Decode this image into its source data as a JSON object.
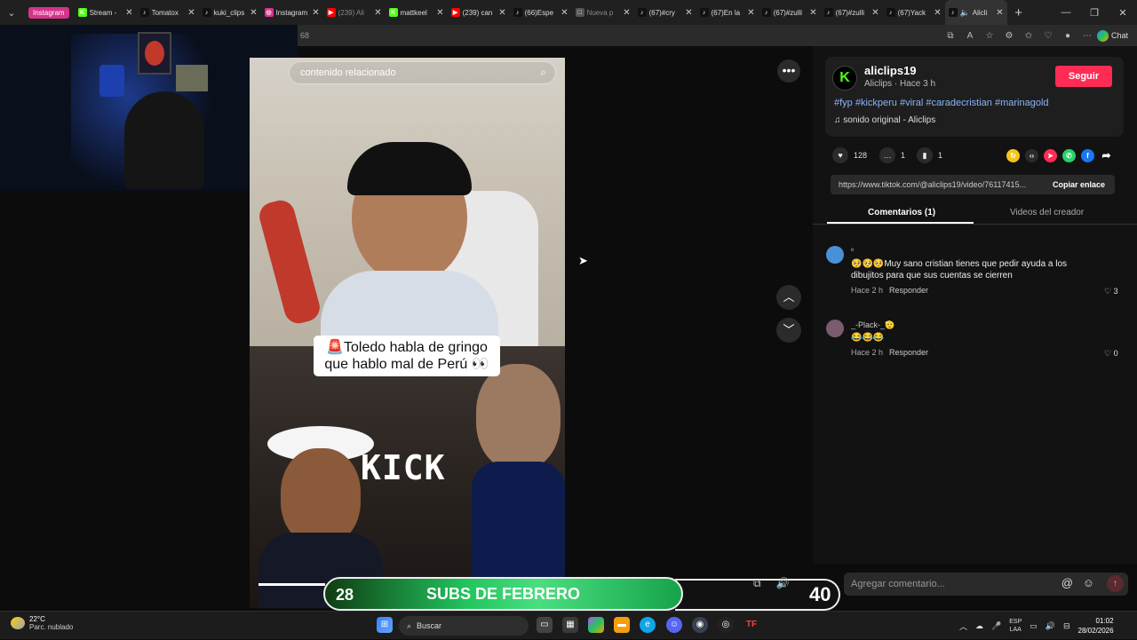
{
  "browser": {
    "group_label": "Instagram",
    "tabs": [
      {
        "title": "Stream -",
        "fav": "K",
        "color": "#53fc18"
      },
      {
        "title": "Tomatox",
        "fav": "♪",
        "color": "#111111"
      },
      {
        "title": "kuki_clips",
        "fav": "♪",
        "color": "#111111"
      },
      {
        "title": "Instagram",
        "fav": "◎",
        "color": "#d6338b"
      },
      {
        "title": "(239) Ali",
        "fav": "▶",
        "color": "#ff0000",
        "dim": true
      },
      {
        "title": "mattkeel",
        "fav": "K",
        "color": "#53fc18"
      },
      {
        "title": "(239) can",
        "fav": "▶",
        "color": "#ff0000"
      },
      {
        "title": "(66)Espe",
        "fav": "♪",
        "color": "#111111"
      },
      {
        "title": "Nueva p",
        "fav": "□",
        "color": "#555555",
        "dim": true
      },
      {
        "title": "(67)#cry",
        "fav": "♪",
        "color": "#111111"
      },
      {
        "title": "(67)En la",
        "fav": "♪",
        "color": "#111111"
      },
      {
        "title": "(67)#zulli",
        "fav": "♪",
        "color": "#111111"
      },
      {
        "title": "(67)#zulli",
        "fav": "♪",
        "color": "#111111"
      },
      {
        "title": "(67)Yack",
        "fav": "♪",
        "color": "#111111"
      }
    ],
    "active_tab": "Alicli",
    "address_fragment": "68",
    "chat_label": "Chat"
  },
  "video": {
    "search_text": "contenido relacionado",
    "caption": "🚨Toledo habla de gringo que hablo mal de Perú 👀",
    "kick_text": "KICK"
  },
  "post": {
    "username": "aliclips19",
    "subline": "Aliclips · Hace 3 h",
    "follow_label": "Seguir",
    "hashtags": "#fyp #kickperu #viral #caradecristian #marinagold",
    "sound": "♫  sonido original - Aliclips",
    "likes": "128",
    "comments": "1",
    "saves": "1",
    "link": "https://www.tiktok.com/@aliclips19/video/76117415...",
    "copy_label": "Copiar enlace",
    "tab_comments": "Comentarios (1)",
    "tab_videos": "Videos del creador"
  },
  "comments": [
    {
      "author": "ᵉ",
      "text": "🥺🥺🥺Muy sano cristian tienes que pedir ayuda a los dibujitos para que sus cuentas se cierren",
      "time": "Hace 2 h",
      "reply": "Responder",
      "likes": "3",
      "avatar_color": "#4a90d9"
    },
    {
      "author": "_-Plack-_🫡",
      "text": "😂😂😂",
      "time": "Hace 2 h",
      "reply": "Responder",
      "likes": "0",
      "avatar_color": "#7a5c6e"
    }
  ],
  "comment_input_placeholder": "Agregar comentario...",
  "overlay": {
    "left_number": "28",
    "label": "SUBS DE FEBRERO",
    "goal": "40"
  },
  "taskbar": {
    "temp": "22°C",
    "weather": "Parc. nublado",
    "search": "Buscar",
    "lang1": "ESP",
    "lang2": "LAA",
    "time": "01:02",
    "date": "28/02/2026"
  }
}
